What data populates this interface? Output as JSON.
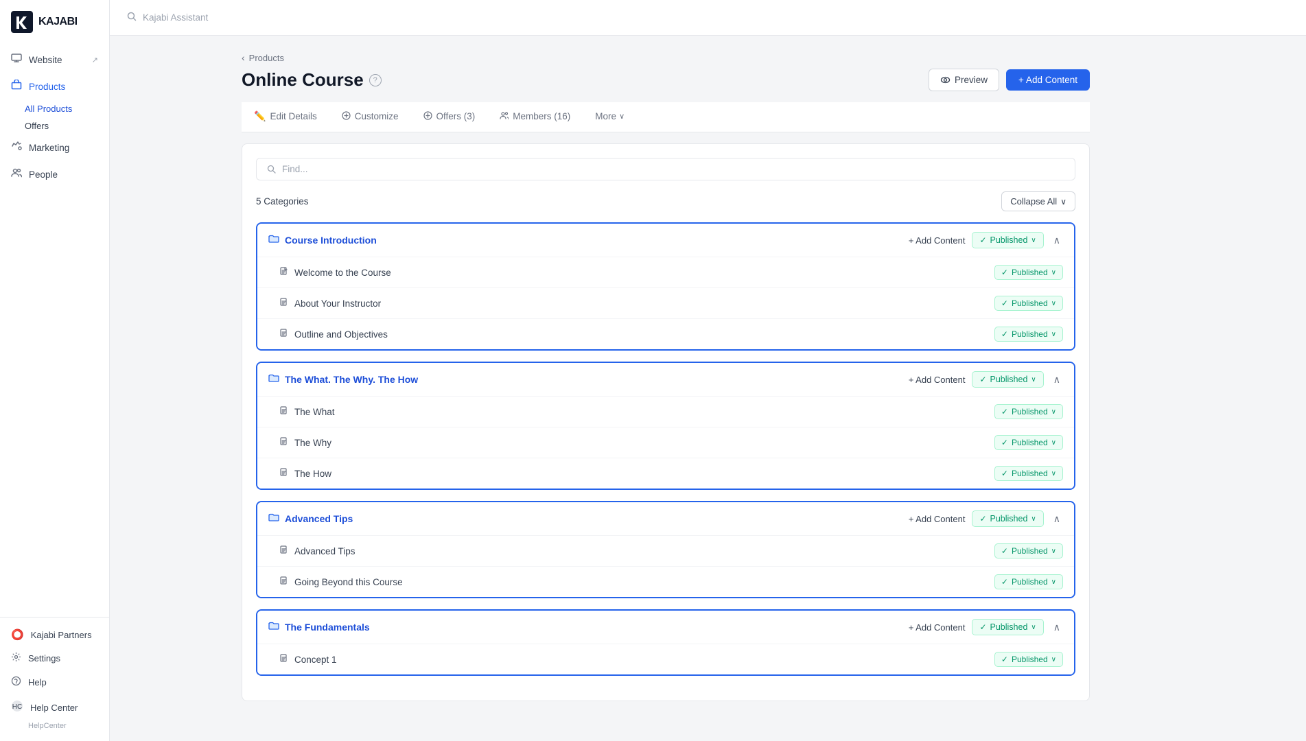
{
  "sidebar": {
    "logo": "KAJABI",
    "items": [
      {
        "id": "website",
        "label": "Website",
        "icon": "🖥️",
        "has_external": true
      },
      {
        "id": "products",
        "label": "Products",
        "icon": "📦"
      },
      {
        "id": "marketing",
        "label": "Marketing",
        "icon": "📢"
      },
      {
        "id": "people",
        "label": "People",
        "icon": "👤"
      }
    ],
    "products_sub": [
      {
        "id": "all-products",
        "label": "All Products",
        "active": true
      },
      {
        "id": "offers",
        "label": "Offers"
      }
    ],
    "bottom": [
      {
        "id": "kajabi-partners",
        "label": "Kajabi Partners",
        "icon": "⭕"
      },
      {
        "id": "settings",
        "label": "Settings",
        "icon": "⚙️"
      },
      {
        "id": "help",
        "label": "Help",
        "icon": "❓"
      },
      {
        "id": "help-center",
        "label": "Help Center",
        "sub_label": "HelpCenter",
        "icon": "💬"
      }
    ]
  },
  "topbar": {
    "search_placeholder": "Kajabi Assistant"
  },
  "page": {
    "breadcrumb": "Products",
    "title": "Online Course",
    "help_icon": "?",
    "preview_btn": "Preview",
    "add_content_btn": "+ Add Content"
  },
  "tabs": [
    {
      "id": "edit-details",
      "label": "Edit Details",
      "icon": "✏️"
    },
    {
      "id": "customize",
      "label": "Customize",
      "icon": "⚙️"
    },
    {
      "id": "offers",
      "label": "Offers (3)",
      "icon": "💬"
    },
    {
      "id": "members",
      "label": "Members (16)",
      "icon": "👥"
    },
    {
      "id": "more",
      "label": "More",
      "icon": "∨"
    }
  ],
  "content": {
    "search_placeholder": "Find...",
    "categories_label": "5 Categories",
    "collapse_all_btn": "Collapse All",
    "categories": [
      {
        "id": "cat-1",
        "title": "Course Introduction",
        "add_content_label": "+ Add Content",
        "status": "Published",
        "items": [
          {
            "id": "item-1-1",
            "title": "Welcome to the Course",
            "status": "Published"
          },
          {
            "id": "item-1-2",
            "title": "About Your Instructor",
            "status": "Published"
          },
          {
            "id": "item-1-3",
            "title": "Outline and Objectives",
            "status": "Published"
          }
        ]
      },
      {
        "id": "cat-2",
        "title": "The What. The Why. The How",
        "add_content_label": "+ Add Content",
        "status": "Published",
        "items": [
          {
            "id": "item-2-1",
            "title": "The What",
            "status": "Published"
          },
          {
            "id": "item-2-2",
            "title": "The Why",
            "status": "Published"
          },
          {
            "id": "item-2-3",
            "title": "The How",
            "status": "Published"
          }
        ]
      },
      {
        "id": "cat-3",
        "title": "Advanced Tips",
        "add_content_label": "+ Add Content",
        "status": "Published",
        "items": [
          {
            "id": "item-3-1",
            "title": "Advanced Tips",
            "status": "Published"
          },
          {
            "id": "item-3-2",
            "title": "Going Beyond this Course",
            "status": "Published"
          }
        ]
      },
      {
        "id": "cat-4",
        "title": "The Fundamentals",
        "add_content_label": "+ Add Content",
        "status": "Published",
        "items": [
          {
            "id": "item-4-1",
            "title": "Concept 1",
            "status": "Published"
          }
        ]
      }
    ]
  }
}
